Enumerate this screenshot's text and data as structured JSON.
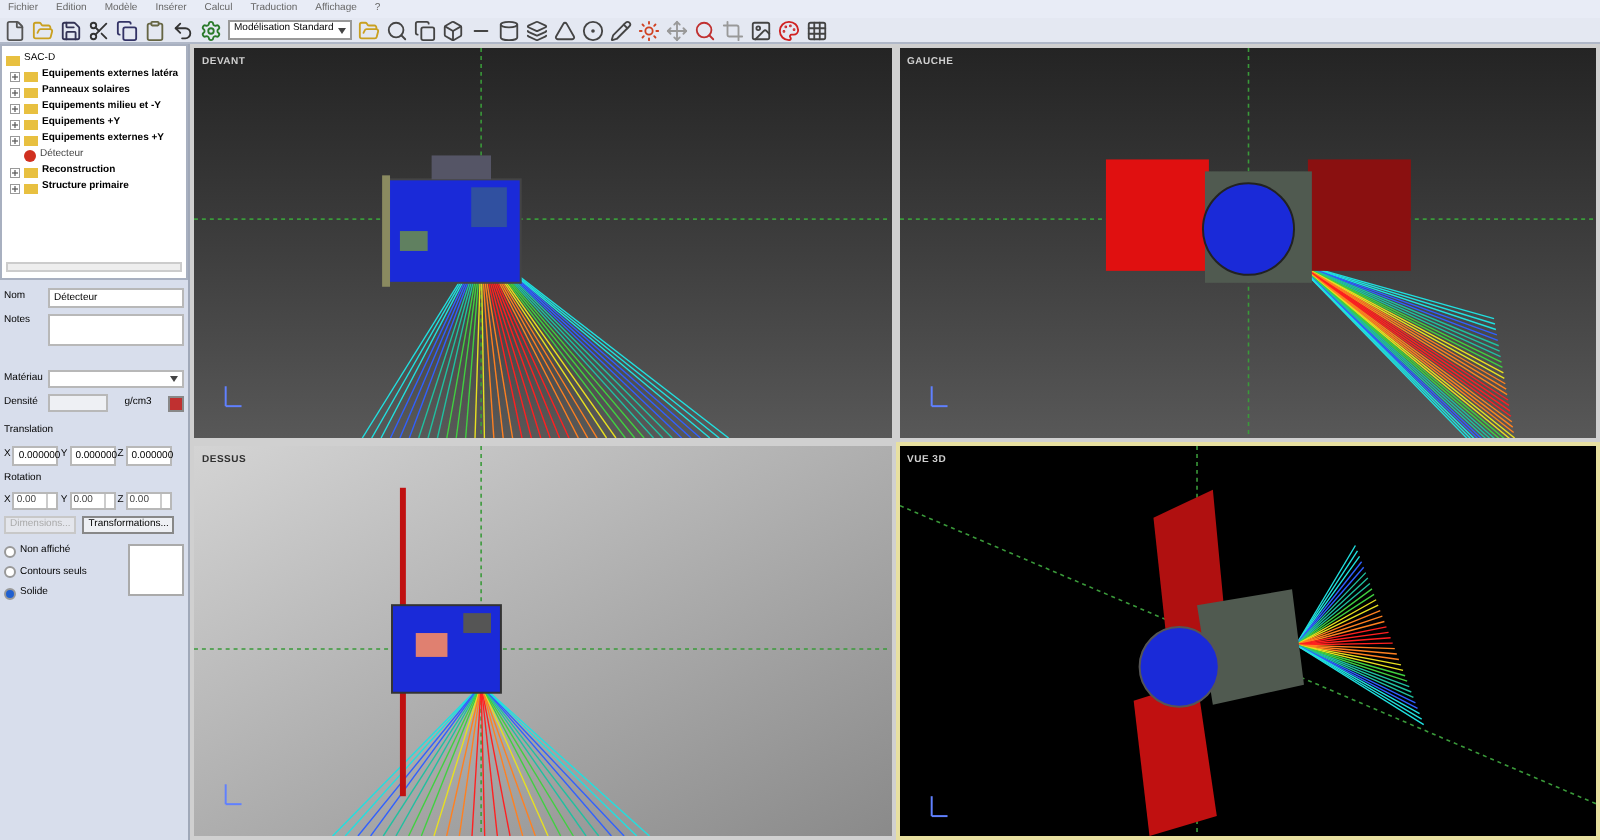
{
  "menu": [
    "Fichier",
    "Edition",
    "Modèle",
    "Insérer",
    "Calcul",
    "Traduction",
    "Affichage",
    "?"
  ],
  "toolbar": {
    "mode": "Modélisation Standard"
  },
  "tree": {
    "label": "SAC-D",
    "expanded": true,
    "children": [
      {
        "label": "Equipements externes latéra",
        "kind": "folder",
        "expanded": false
      },
      {
        "label": "Panneaux solaires",
        "kind": "folder",
        "expanded": false
      },
      {
        "label": "Equipements milieu et -Y",
        "kind": "folder",
        "expanded": false
      },
      {
        "label": "Equipements +Y",
        "kind": "folder",
        "expanded": false
      },
      {
        "label": "Equipements externes +Y",
        "kind": "folder",
        "expanded": false
      },
      {
        "label": "Détecteur",
        "kind": "part"
      },
      {
        "label": "Reconstruction",
        "kind": "folder",
        "expanded": false
      },
      {
        "label": "Structure primaire",
        "kind": "folder",
        "expanded": false
      }
    ]
  },
  "properties": {
    "name_label": "Nom",
    "name_value": "Détecteur",
    "notes_label": "Notes",
    "material_label": "Matériau",
    "density_label": "Densité",
    "density_unit": "g/cm3",
    "translation_label": "Translation",
    "translation": [
      {
        "axis": "X",
        "value": "0.000000"
      },
      {
        "axis": "Y",
        "value": "0.000000"
      },
      {
        "axis": "Z",
        "value": "0.000000"
      }
    ],
    "rotation_label": "Rotation",
    "rotation": [
      {
        "axis": "X",
        "value": "0.00"
      },
      {
        "axis": "Y",
        "value": "0.00"
      },
      {
        "axis": "Z",
        "value": "0.00"
      }
    ],
    "buttons": [
      {
        "label": "Dimensions...",
        "disabled": true
      },
      {
        "label": "Transformations...",
        "disabled": false
      }
    ],
    "display": [
      {
        "label": "Non affiché",
        "selected": false
      },
      {
        "label": "Contours seuls",
        "selected": false
      },
      {
        "label": "Solide",
        "selected": true
      }
    ]
  },
  "viewports": [
    {
      "label": "DEVANT",
      "kind": "front",
      "selected": false
    },
    {
      "label": "GAUCHE",
      "kind": "side",
      "selected": false
    },
    {
      "label": "DESSUS",
      "kind": "top",
      "selected": false
    },
    {
      "label": "VUE 3D",
      "kind": "perspective",
      "selected": true
    }
  ]
}
